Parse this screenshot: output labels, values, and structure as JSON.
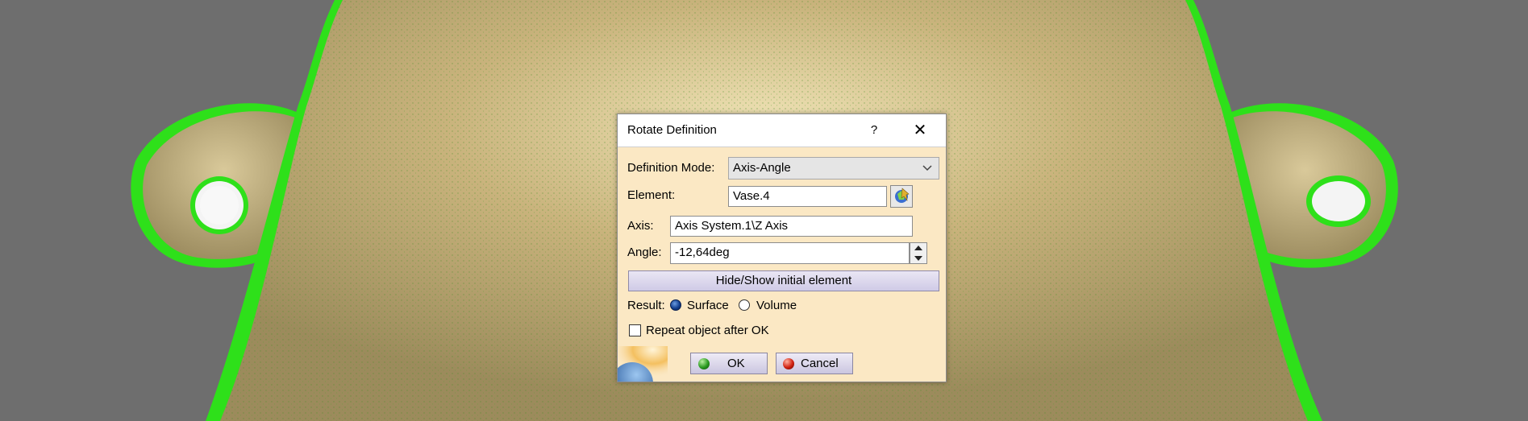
{
  "dialog": {
    "title": "Rotate Definition",
    "help_label": "?",
    "close_label": "✕",
    "definition_mode_label": "Definition Mode:",
    "definition_mode_value": "Axis-Angle",
    "element_label": "Element:",
    "element_value": "Vase.4",
    "axis_label": "Axis:",
    "axis_value": "Axis System.1\\Z Axis",
    "angle_label": "Angle:",
    "angle_value": "-12,64deg",
    "hide_show_label": "Hide/Show initial element",
    "result_label": "Result:",
    "result_options": [
      {
        "label": "Surface",
        "checked": true
      },
      {
        "label": "Volume",
        "checked": false
      }
    ],
    "repeat_label": "Repeat object after OK",
    "repeat_checked": false,
    "ok_label": "OK",
    "cancel_label": "Cancel"
  },
  "icons": {
    "chevron": "chevron-down-icon",
    "picker": "element-picker-icon",
    "ok": "green-dot-icon",
    "cancel": "red-dot-icon"
  },
  "colors": {
    "viewport_bg": "#6e6e6e",
    "model_surface": "#c9b37c",
    "point_cloud": "#2ee01a",
    "dialog_bg": "#fbe8c4",
    "button_bg": "#d8d4ea"
  }
}
